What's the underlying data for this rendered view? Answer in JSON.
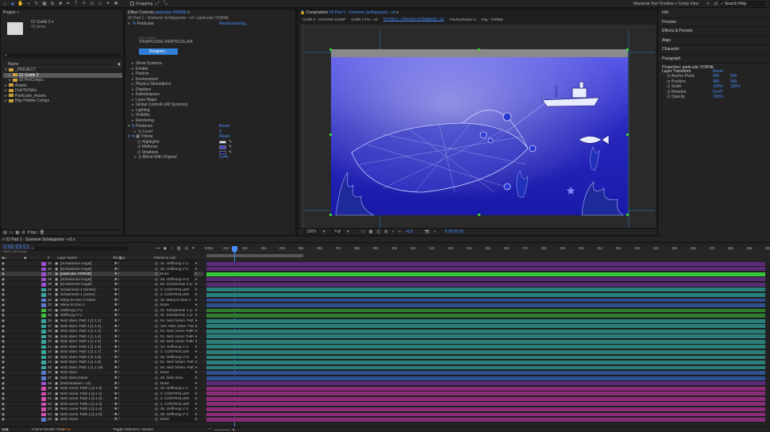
{
  "toolbar": {
    "snapping_label": "Snapping",
    "workspace": "Macbook Text Timeline > Comp View",
    "search_placeholder": "Search Help"
  },
  "project": {
    "title": "Project",
    "comp_name": "01 Grafik 2 ▾",
    "comp_info": "43 items",
    "name_header": "Name",
    "items": [
      {
        "name": "_PROJECT",
        "indent": 0,
        "type": "folder",
        "open": true
      },
      {
        "name": "01 Grafik 2",
        "indent": 1,
        "type": "folder",
        "open": false,
        "selected": true
      },
      {
        "name": "02 PreComps",
        "indent": 1,
        "type": "folder",
        "open": false
      },
      {
        "name": "Assets",
        "indent": 0,
        "type": "folder",
        "open": false
      },
      {
        "name": "FishTikTalks",
        "indent": 0,
        "type": "folder",
        "open": false
      },
      {
        "name": "Particular_Assets",
        "indent": 0,
        "type": "folder",
        "open": false
      },
      {
        "name": "Ray Palette Comps",
        "indent": 0,
        "type": "folder",
        "open": false
      }
    ],
    "footer_bpc": "8 bpc"
  },
  "effects": {
    "title": "Effect Controls",
    "layer": "particular VORNE",
    "path": "02 Part 1 - Szenerie Schleppnetz - v3 • particular VORNE",
    "fx_name": "Particular",
    "reset_label": "Reset",
    "licensing_label": "Licensing...",
    "brand_top": "RED GIANT",
    "brand_name": "TRAPCODE PARTICULAR",
    "designer_label": "Designer...",
    "groups": [
      "Show Systems",
      "Emitter",
      "Particle",
      "Environment",
      "Physics Simulations",
      "Displace",
      "Kaleidospace",
      "Layer Maps",
      "Global Controls (All Systems)",
      "Lighting",
      "Visibility",
      "Rendering"
    ],
    "posterize": {
      "name": "Posterize",
      "reset": "Reset",
      "level_label": "Level",
      "level_value": "3"
    },
    "tritone": {
      "name": "Tritone",
      "reset": "Reset",
      "highlights_label": "Highlights",
      "midtones_label": "Midtones",
      "shadows_label": "Shadows",
      "blend_label": "Blend With Original",
      "blend_value": "0,0%",
      "highlight_color": "#e6ecff",
      "midtone_color": "#4a4ae0",
      "shadow_color": "#0a0a6e"
    }
  },
  "comp": {
    "title": "Composition",
    "comp_name": "02 Part 1 - Szenerie Schleppnetz - v3",
    "tabs": [
      "Grafik 2 - MASTER COMP",
      "Grafik 2 Pre - v3",
      "02 Part 1 - Szenerie Schleppnetz - v3",
      "Fischschwarm 3",
      "Ray - FARBE"
    ],
    "active_tab": 2,
    "zoom": "100%",
    "resolution": "Full",
    "exposure": "+0,0",
    "timecode": "0:00:03:01"
  },
  "right_panel": {
    "items": [
      "Info",
      "Preview",
      "Effects & Presets",
      "Align",
      "Character",
      "Paragraph"
    ],
    "properties_title": "Properties: particular VORNE",
    "layer_transform": "Layer Transform",
    "reset_label": "Reset",
    "props": [
      {
        "name": "Anchor Point",
        "v1": "960",
        "v2": "540"
      },
      {
        "name": "Position",
        "v1": "960",
        "v2": "540"
      },
      {
        "name": "Scale",
        "v1": "100%",
        "v2": "100%"
      },
      {
        "name": "Rotation",
        "v1": "0x+0°",
        "v2": ""
      },
      {
        "name": "Opacity",
        "v1": "100%",
        "v2": ""
      }
    ]
  },
  "timeline": {
    "title": "02 Part 1 - Szenerie Schleppnetz - v3",
    "timecode": "0:00:03:01",
    "fps": "00091 (30.00 fps)",
    "col_source": "Layer Name",
    "col_parent": "Parent & Link",
    "col_hash": "#",
    "ruler": [
      "0:00s",
      "01s",
      "02s",
      "03s",
      "04s",
      "05s",
      "06s",
      "07s",
      "08s",
      "09s",
      "10s",
      "11s",
      "12s",
      "13s",
      "14s",
      "15s",
      "16s",
      "17s",
      "18s",
      "19s",
      "20s",
      "21s",
      "22s",
      "23s",
      "24s",
      "25s",
      "26s",
      "27s",
      "28s",
      "29s",
      "30s"
    ],
    "frame_render_label": "Frame Render Time",
    "frame_render_value": "47ms",
    "toggle_label": "Toggle Switches / Modes",
    "layers": [
      {
        "num": "25",
        "name": "[Schwimmer Kugel]",
        "parent": "34. Oeffnung V U",
        "color": "#9c4fd0",
        "bar": "#5b2b78"
      },
      {
        "num": "26",
        "name": "[Schwimmer Kugel]",
        "parent": "35. Oeffnung V U",
        "color": "#9c4fd0",
        "bar": "#5b2b78"
      },
      {
        "num": "27",
        "name": "[particular VORNE]",
        "parent": "None",
        "color": "#9c4fd0",
        "bar": "#38c93a",
        "sel": true
      },
      {
        "num": "28",
        "name": "[Schwimmer Kugel]",
        "parent": "49. Oeffnung H O",
        "color": "#9c4fd0",
        "bar": "#5b2b78"
      },
      {
        "num": "29",
        "name": "[Schwimmer Kugel]",
        "parent": "50. Schwimmer 2 (v",
        "color": "#9c4fd0",
        "bar": "#5b2b78"
      },
      {
        "num": "30",
        "name": "Schwimmer 2 (hinten)",
        "parent": "3. CONTROLLER",
        "color": "#3aa6a0",
        "bar": "#2b7f7b"
      },
      {
        "num": "31",
        "name": "Schwimmer 1 (vorne)",
        "parent": "3. CONTROLLER",
        "color": "#3aa6a0",
        "bar": "#2b7f7b"
      },
      {
        "num": "32",
        "name": "Many-to-One 1-Clone",
        "parent": "33. Many-to-One 1",
        "color": "#5a7ad0",
        "bar": "#2f4f8f"
      },
      {
        "num": "33",
        "name": "Many-to-One 1",
        "parent": "None",
        "color": "#5a7ad0",
        "bar": "#2f4f8f"
      },
      {
        "num": "34",
        "name": "Oeffnung V U",
        "parent": "31. Schwimmer 1 (v",
        "color": "#3dbb3d",
        "bar": "#2e7d2e"
      },
      {
        "num": "35",
        "name": "Oeffnung V U",
        "parent": "31. Schwimmer 1 (v",
        "color": "#3dbb3d",
        "bar": "#2e7d2e"
      },
      {
        "num": "36",
        "name": "Netz oben: Path 1 [1.1.1]",
        "parent": "94. Netz hinten: Path",
        "color": "#3aa6a0",
        "bar": "#2b7f7b"
      },
      {
        "num": "37",
        "name": "Netz oben: Path 1 [1.1.2]",
        "parent": "103. Netz unten: Pat",
        "color": "#3aa6a0",
        "bar": "#2b7f7b"
      },
      {
        "num": "38",
        "name": "Netz oben: Path 1 [1.1.3]",
        "parent": "52. Netz vorne: Path",
        "color": "#3aa6a0",
        "bar": "#2b7f7b"
      },
      {
        "num": "39",
        "name": "Netz oben: Path 1 [1.1.4]",
        "parent": "51. Netz vorne: Path",
        "color": "#3aa6a0",
        "bar": "#2b7f7b"
      },
      {
        "num": "40",
        "name": "Netz oben: Path 1 [1.1.5]",
        "parent": "53. Netz vorne: Path",
        "color": "#3aa6a0",
        "bar": "#2b7f7b"
      },
      {
        "num": "41",
        "name": "Netz oben: Path 1 [1.1.6]",
        "parent": "34. Oeffnung V U",
        "color": "#3aa6a0",
        "bar": "#2b7f7b"
      },
      {
        "num": "42",
        "name": "Netz oben: Path 1 [1.1.7]",
        "parent": "3. CONTROLLER",
        "color": "#3aa6a0",
        "bar": "#2b7f7b"
      },
      {
        "num": "43",
        "name": "Netz oben: Path 1 [1.1.8]",
        "parent": "49. Oeffnung H O",
        "color": "#3aa6a0",
        "bar": "#2b7f7b"
      },
      {
        "num": "44",
        "name": "Netz oben: Path 1 [1.1.9]",
        "parent": "91. Netz hinten: Path",
        "color": "#3aa6a0",
        "bar": "#2b7f7b"
      },
      {
        "num": "45",
        "name": "Netz oben: Path 1 [1.1.10]",
        "parent": "93. Netz hinten: Path",
        "color": "#3aa6a0",
        "bar": "#2b7f7b"
      },
      {
        "num": "46",
        "name": "Netz oben",
        "parent": "None",
        "color": "#5a7ad0",
        "bar": "#2f4f8f"
      },
      {
        "num": "47",
        "name": "Netz oben-Clone",
        "parent": "46. Netz oben",
        "color": "#5a7ad0",
        "bar": "#2f4f8f"
      },
      {
        "num": "48",
        "name": "[Netzsimation - v4]",
        "parent": "None",
        "color": "#9c4fd0",
        "bar": "#5b2b78"
      },
      {
        "num": "49",
        "name": "Netz vorne: Path 1 [1.1.0]",
        "parent": "34. Oeffnung V U",
        "color": "#d04fb0",
        "bar": "#8a2d78"
      },
      {
        "num": "50",
        "name": "Netz vorne: Path 1 [1.1.1]",
        "parent": "3. CONTROLLER",
        "color": "#d04fb0",
        "bar": "#8a2d78"
      },
      {
        "num": "51",
        "name": "Netz vorne: Path 1 [1.1.2]",
        "parent": "3. CONTROLLER",
        "color": "#d04fb0",
        "bar": "#8a2d78"
      },
      {
        "num": "52",
        "name": "Netz vorne: Path 1 [1.1.3]",
        "parent": "3. CONTROLLER",
        "color": "#d04fb0",
        "bar": "#8a2d78"
      },
      {
        "num": "53",
        "name": "Netz vorne: Path 1 [1.1.4]",
        "parent": "35. Oeffnung V U",
        "color": "#d04fb0",
        "bar": "#8a2d78"
      },
      {
        "num": "54",
        "name": "Netz vorne: Path 1 [1.1.5]",
        "parent": "35. Oeffnung V U",
        "color": "#d04fb0",
        "bar": "#8a2d78"
      },
      {
        "num": "55",
        "name": "Netz vorne",
        "parent": "None",
        "color": "#5a7ad0",
        "bar": "#8a2d78"
      }
    ]
  }
}
